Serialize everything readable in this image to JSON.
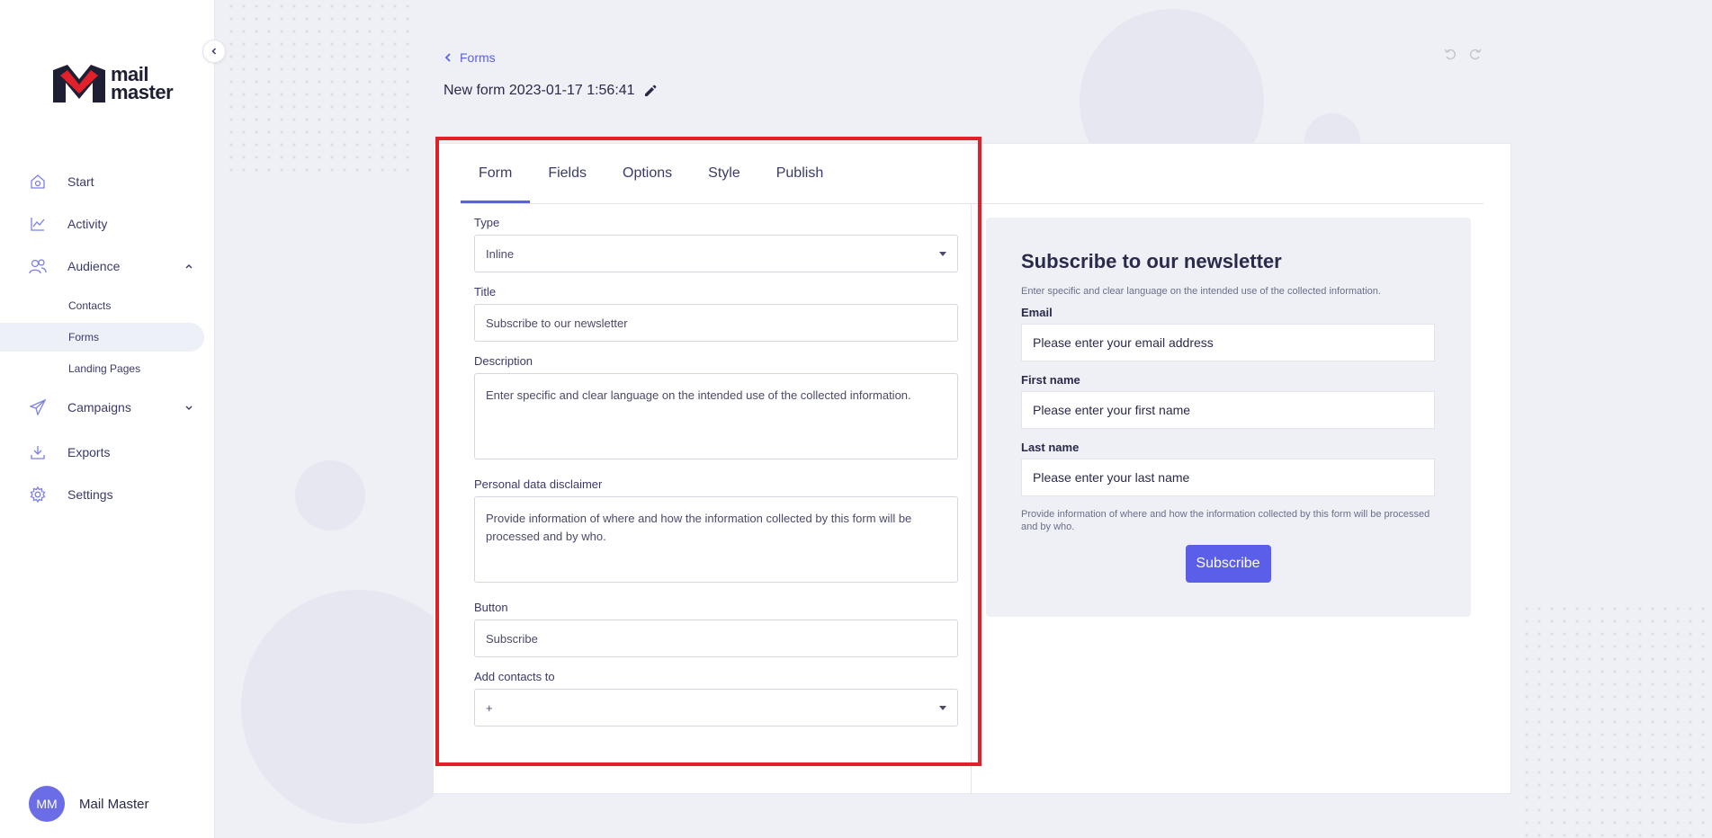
{
  "app": {
    "logo_line1": "mail",
    "logo_line2": "master"
  },
  "sidebar": {
    "items": [
      {
        "label": "Start",
        "icon": "home-icon"
      },
      {
        "label": "Activity",
        "icon": "chart-line-icon"
      },
      {
        "label": "Audience",
        "icon": "users-icon",
        "expanded": true
      },
      {
        "label": "Campaigns",
        "icon": "paper-plane-icon",
        "expanded": false
      },
      {
        "label": "Exports",
        "icon": "download-icon"
      },
      {
        "label": "Settings",
        "icon": "gear-icon"
      }
    ],
    "audience_sub": [
      {
        "label": "Contacts"
      },
      {
        "label": "Forms",
        "active": true
      },
      {
        "label": "Landing Pages"
      }
    ],
    "user": {
      "initials": "MM",
      "name": "Mail Master"
    }
  },
  "header": {
    "breadcrumb": "Forms",
    "title": "New form 2023-01-17 1:56:41"
  },
  "tabs": [
    {
      "label": "Form",
      "active": true
    },
    {
      "label": "Fields"
    },
    {
      "label": "Options"
    },
    {
      "label": "Style"
    },
    {
      "label": "Publish"
    }
  ],
  "form": {
    "type_label": "Type",
    "type_value": "Inline",
    "title_label": "Title",
    "title_value": "Subscribe to our newsletter",
    "description_label": "Description",
    "description_value": "Enter specific and clear language on the intended use of the collected information.",
    "disclaimer_label": "Personal data disclaimer",
    "disclaimer_value": "Provide information of where and how the information collected by this form will be processed and by who.",
    "button_label": "Button",
    "button_value": "Subscribe",
    "add_contacts_label": "Add contacts to",
    "add_contacts_value": "+"
  },
  "preview": {
    "title": "Subscribe to our newsletter",
    "description": "Enter specific and clear language on the intended use of the collected information.",
    "email_label": "Email",
    "email_placeholder": "Please enter your email address",
    "first_label": "First name",
    "first_placeholder": "Please enter your first name",
    "last_label": "Last name",
    "last_placeholder": "Please enter your last name",
    "disclaimer": "Provide information of where and how the information collected by this form will be processed and by who.",
    "button": "Subscribe"
  },
  "colors": {
    "accent": "#5b5ee8",
    "highlight": "#e0202a",
    "background": "#eff0f6"
  }
}
